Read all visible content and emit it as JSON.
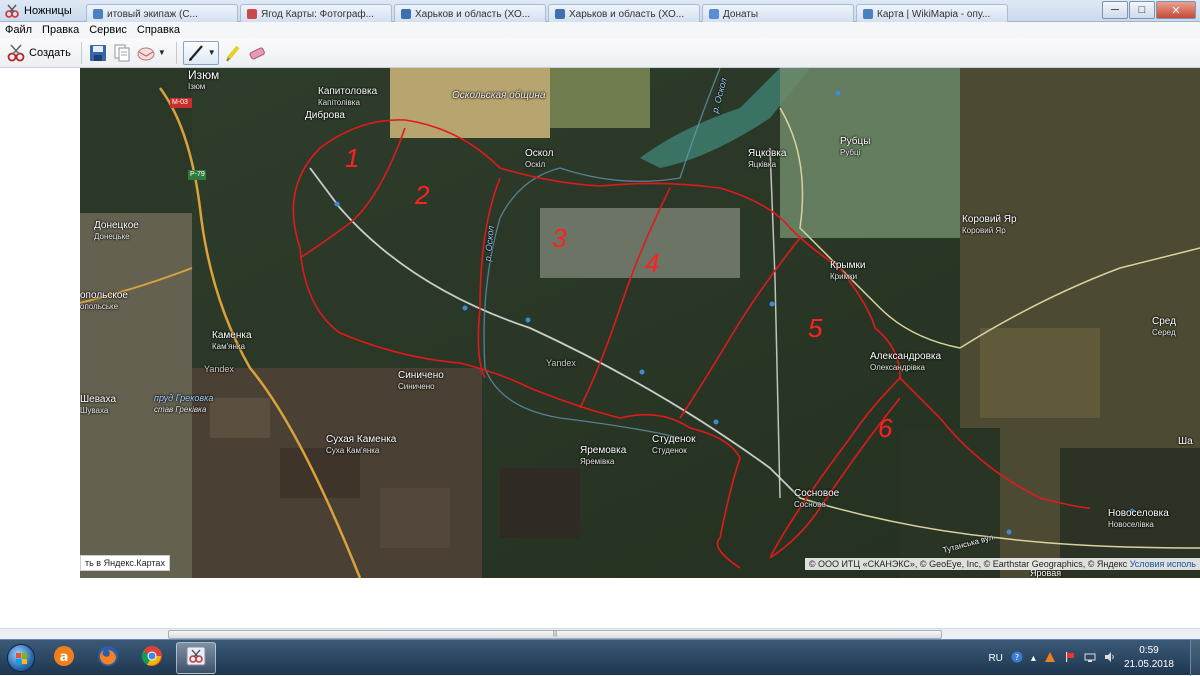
{
  "window": {
    "app_title": "Ножницы",
    "tabs": [
      {
        "label": "итовый экипаж (С...",
        "color": "#4a7fc1"
      },
      {
        "label": "Ягод Карты: Фотограф...",
        "color": "#c84a4a"
      },
      {
        "label": "Харьков и область (ХО...",
        "color": "#3f6fb0"
      },
      {
        "label": "Харьков и область (ХО...",
        "color": "#3f6fb0"
      },
      {
        "label": "Донаты",
        "color": "#5b8dd6"
      },
      {
        "label": "Карта | WikiMapia - опу...",
        "color": "#4a7fc1"
      }
    ],
    "controls": {
      "minimize": "─",
      "maximize": "□",
      "close": "✕"
    }
  },
  "menu": [
    "Файл",
    "Правка",
    "Сервис",
    "Справка"
  ],
  "toolbar": {
    "create_label": "Создать",
    "icons": [
      "scissors-icon",
      "save-icon",
      "copy-icon",
      "eraser-send-icon",
      "pen-icon",
      "highlighter-icon",
      "eraser-icon"
    ]
  },
  "map": {
    "places": [
      {
        "name": "Изюм",
        "sub": "Ізюм",
        "big": true
      },
      {
        "name": "Капитоловка",
        "sub": "Капітолівка"
      },
      {
        "name": "Диброва",
        "sub": ""
      },
      {
        "name": "Оскольская община",
        "sub": ""
      },
      {
        "name": "Оскол",
        "sub": "Оскіл"
      },
      {
        "name": "Яцковка",
        "sub": "Яцківка"
      },
      {
        "name": "Рубцы",
        "sub": "Рубці"
      },
      {
        "name": "Коровий Яр",
        "sub": "Коровий Яр"
      },
      {
        "name": "Донецкое",
        "sub": "Донецьке"
      },
      {
        "name": "Крымки",
        "sub": "Кримки"
      },
      {
        "name": "опольское",
        "sub": "опольське"
      },
      {
        "name": "Каменка",
        "sub": "Кам'янка"
      },
      {
        "name": "Синичено",
        "sub": "Синичено"
      },
      {
        "name": "Александровка",
        "sub": "Олександрівка"
      },
      {
        "name": "Шевахa",
        "sub": "Шуваха"
      },
      {
        "name": "Сухая Каменка",
        "sub": "Суха Кам'янка"
      },
      {
        "name": "Яремовка",
        "sub": "Яремівка"
      },
      {
        "name": "Студенок",
        "sub": "Студенок"
      },
      {
        "name": "Сосновое",
        "sub": "Соснове"
      },
      {
        "name": "Новоселовка",
        "sub": "Новоселівка"
      },
      {
        "name": "Сред",
        "sub": "Серед"
      },
      {
        "name": "Ша",
        "sub": ""
      },
      {
        "name": "Яровая",
        "sub": ""
      },
      {
        "name": "Yandex",
        "sub": ""
      },
      {
        "name": "Yandex",
        "sub": ""
      }
    ],
    "rivers": [
      "р. Оскол",
      "р. Оскол",
      "пруд Грековка",
      "став Греківка"
    ],
    "roads": [
      "М-03",
      "Р-79"
    ],
    "zone_numbers": [
      "1",
      "2",
      "3",
      "4",
      "5",
      "6"
    ],
    "link_text": "ть в Яндекс.Картах",
    "copyright": "© ООО ИТЦ «СКАНЭКС», © GeoEye, Inc, © Earthstar Geographics, © Яндекс",
    "terms_link": "Условия исполь",
    "road_label": "Тутанська вул."
  },
  "taskbar": {
    "apps": [
      "avast-icon",
      "firefox-icon",
      "chrome-icon",
      "snipping-tool-icon"
    ],
    "language": "RU",
    "time": "0:59",
    "date": "21.05.2018"
  }
}
